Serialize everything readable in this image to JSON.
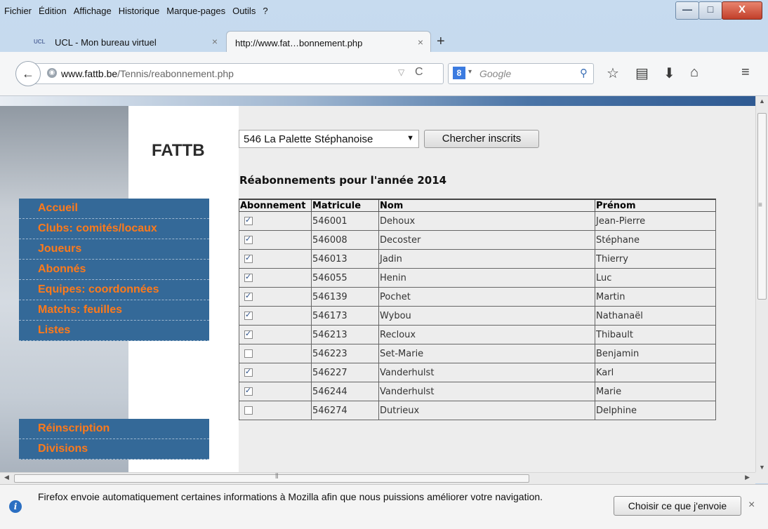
{
  "menu": [
    "Fichier",
    "Édition",
    "Affichage",
    "Historique",
    "Marque-pages",
    "Outils",
    "?"
  ],
  "window_controls": {
    "minimize": "—",
    "maximize": "□",
    "close": "X"
  },
  "tabs": [
    {
      "badge": "UCL",
      "label": "UCL - Mon bureau virtuel",
      "close": "×"
    },
    {
      "label": "http://www.fat…bonnement.php",
      "close": "×"
    }
  ],
  "new_tab": "+",
  "nav": {
    "back": "←",
    "url_domain": "www.fattb.be",
    "url_path": "/Tennis/reabonnement.php",
    "search_engine_badge": "8",
    "search_placeholder": "Google"
  },
  "site": {
    "logo": "FATTB",
    "menu_primary": [
      "Accueil",
      "Clubs: comités/locaux",
      "Joueurs",
      "Abonnés",
      "Equipes: coordonnées",
      "Matchs: feuilles",
      "Listes"
    ],
    "menu_secondary": [
      "Réinscription",
      "Divisions"
    ]
  },
  "form": {
    "club_select": "546 La Palette Stéphanoise",
    "search_button": "Chercher inscrits",
    "heading": "Réabonnements pour l'année 2014"
  },
  "table": {
    "headers": [
      "Abonnement",
      "Matricule",
      "Nom",
      "Prénom"
    ],
    "rows": [
      {
        "checked": true,
        "matricule": "546001",
        "nom": "Dehoux",
        "prenom": "Jean-Pierre"
      },
      {
        "checked": true,
        "matricule": "546008",
        "nom": "Decoster",
        "prenom": "Stéphane"
      },
      {
        "checked": true,
        "matricule": "546013",
        "nom": "Jadin",
        "prenom": "Thierry"
      },
      {
        "checked": true,
        "matricule": "546055",
        "nom": "Henin",
        "prenom": "Luc"
      },
      {
        "checked": true,
        "matricule": "546139",
        "nom": "Pochet",
        "prenom": "Martin"
      },
      {
        "checked": true,
        "matricule": "546173",
        "nom": "Wybou",
        "prenom": "Nathanaël"
      },
      {
        "checked": true,
        "matricule": "546213",
        "nom": "Recloux",
        "prenom": "Thibault"
      },
      {
        "checked": false,
        "matricule": "546223",
        "nom": "Set-Marie",
        "prenom": "Benjamin"
      },
      {
        "checked": true,
        "matricule": "546227",
        "nom": "Vanderhulst",
        "prenom": "Karl"
      },
      {
        "checked": true,
        "matricule": "546244",
        "nom": "Vanderhulst",
        "prenom": "Marie"
      },
      {
        "checked": false,
        "matricule": "546274",
        "nom": "Dutrieux",
        "prenom": "Delphine"
      }
    ]
  },
  "notification": {
    "message": "Firefox envoie automatiquement certaines informations à Mozilla afin que nous puissions améliorer votre navigation.",
    "button": "Choisir ce que j'envoie",
    "close": "×"
  },
  "colors": {
    "nav_bg": "#346998",
    "nav_text": "#ff7a1a",
    "content_bg": "#ededed"
  }
}
